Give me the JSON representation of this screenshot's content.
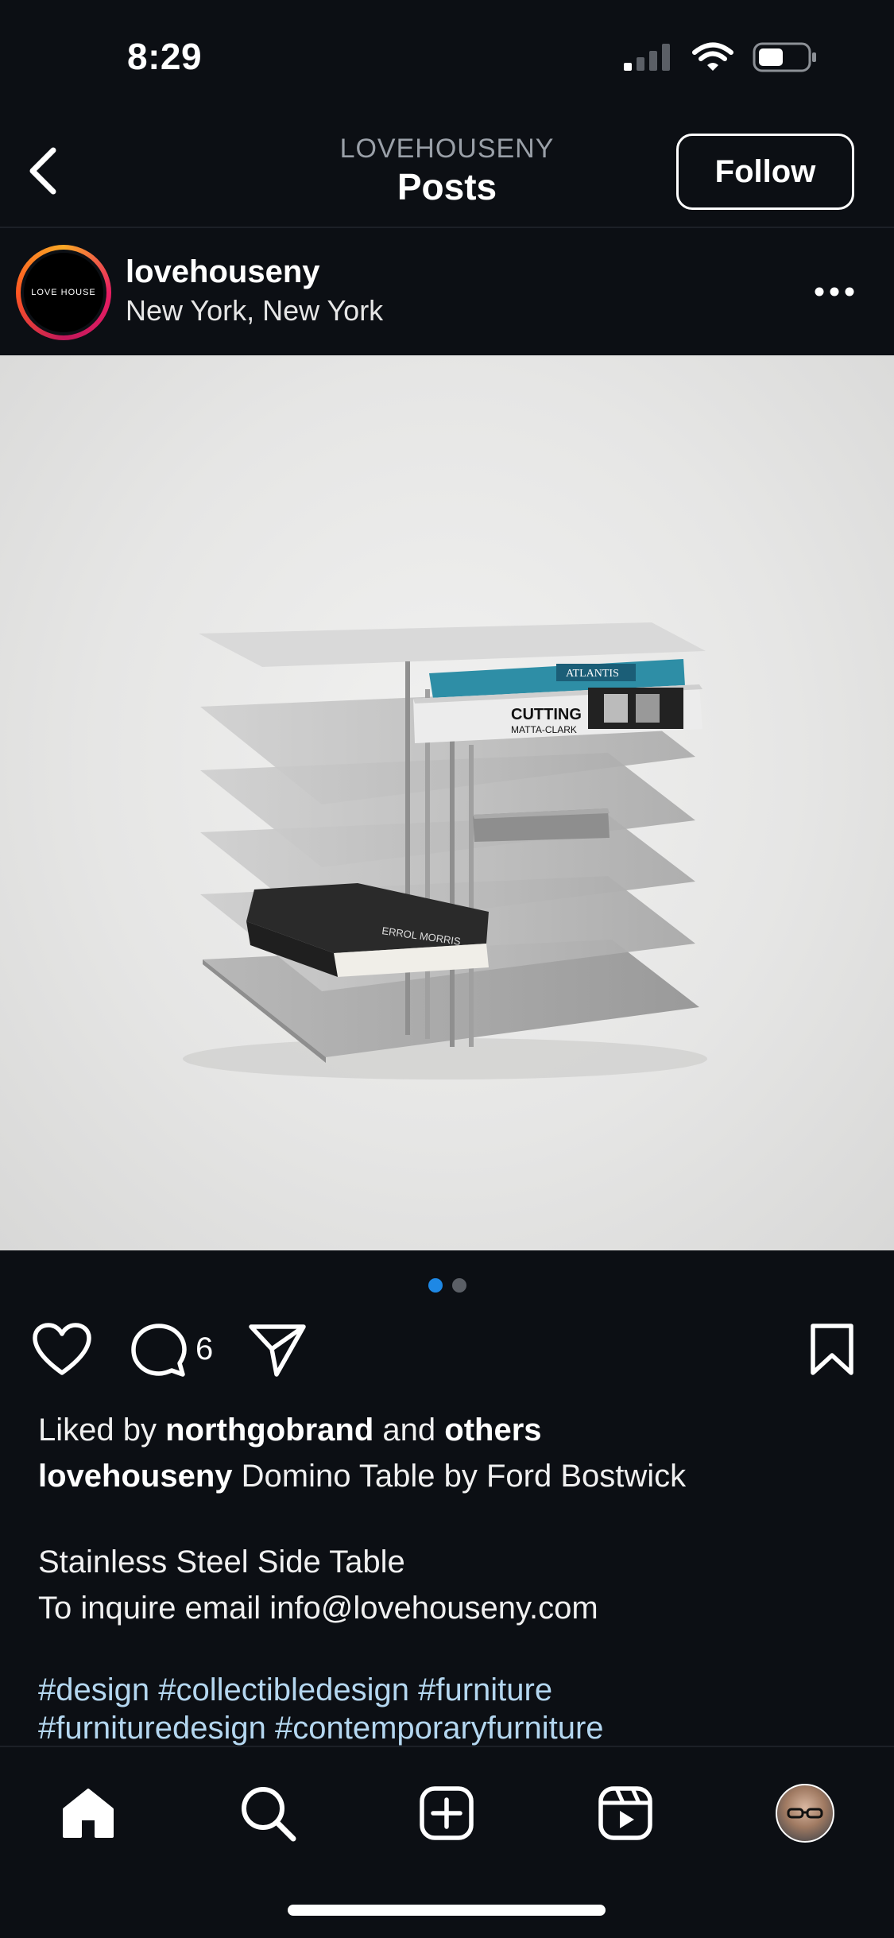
{
  "status_bar": {
    "time": "8:29"
  },
  "header": {
    "account": "LOVEHOUSENY",
    "title": "Posts",
    "follow_label": "Follow"
  },
  "post": {
    "username": "lovehouseny",
    "location": "New York, New York",
    "avatar_text": "LOVE HOUSE",
    "comment_count": "6",
    "carousel": {
      "count": 2,
      "active": 0
    },
    "liked_by_prefix": "Liked by",
    "liked_by_user": "northgobrand",
    "liked_by_and": "and",
    "liked_by_others": "others",
    "caption_user": "lovehouseny",
    "caption_text": "Domino Table by Ford Bostwick",
    "caption_line2": "Stainless Steel Side Table",
    "caption_line3": "To inquire email info@lovehouseny.com",
    "hashtags_line1": "#design #collectibledesign #furniture",
    "hashtags_line2": "#furnituredesign #contemporaryfurniture"
  },
  "image_text": {
    "book1_spine": "ATLANTIS",
    "book2_spine": "CUTTING",
    "book2_author": "MATTA-CLARK",
    "book3_author": "ERROL MORRIS"
  },
  "colors": {
    "background": "#0c0f14",
    "accent_blue": "#1e88e5",
    "hashtag": "#b4d7f0"
  },
  "icons": {
    "back": "chevron-left-icon",
    "more": "more-horizontal-icon",
    "like": "heart-icon",
    "comment": "comment-icon",
    "share": "paper-plane-icon",
    "save": "bookmark-icon",
    "home": "home-icon",
    "search": "search-icon",
    "create": "plus-square-icon",
    "reels": "reels-icon",
    "profile": "profile-avatar"
  }
}
